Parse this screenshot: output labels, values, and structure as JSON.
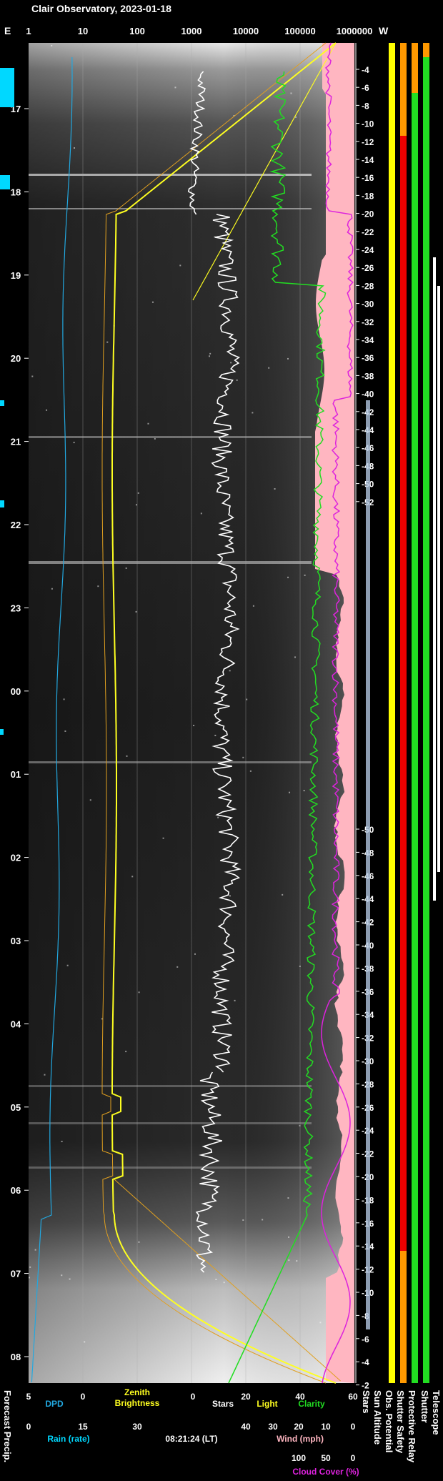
{
  "title": "Clair Observatory, 2023-01-18",
  "corner_label": "E",
  "right_header": "W",
  "colors": {
    "dpd": "#22a8e0",
    "brightness": "#ffff20",
    "brightness_alt": "#e0a020",
    "stars": "#ffffff",
    "clarity": "#22dd22",
    "cloud": "#dd22dd",
    "wind": "#ffb6c1",
    "rain": "#00d8ff",
    "sun": "#ffff00",
    "red": "#ee0000",
    "green": "#22dd22",
    "orange": "#ff9900"
  },
  "chart_data": {
    "type": "line",
    "time_labels": [
      "17",
      "18",
      "19",
      "20",
      "21",
      "22",
      "23",
      "00",
      "01",
      "02",
      "03",
      "04",
      "05",
      "06",
      "07",
      "08"
    ],
    "top_axis": {
      "labels": [
        "1",
        "10",
        "100",
        "1000",
        "10000",
        "100000",
        "1000000"
      ],
      "scale": "log"
    },
    "sun_altitude_labels_top": [
      "-4",
      "-6",
      "-8",
      "-10",
      "-12",
      "-14",
      "-16",
      "-18",
      "-20",
      "-22",
      "-24",
      "-26",
      "-28",
      "-30",
      "-32",
      "-34",
      "-36",
      "-38",
      "-40",
      "-42",
      "-44",
      "-46",
      "-48",
      "-50",
      "-52"
    ],
    "sun_altitude_labels_bottom": [
      "-50",
      "-48",
      "-46",
      "-44",
      "-42",
      "-40",
      "-38",
      "-36",
      "-34",
      "-32",
      "-30",
      "-28",
      "-26",
      "-24",
      "-22",
      "-20",
      "-18",
      "-16",
      "-14",
      "-12",
      "-10",
      "-8",
      "-6",
      "-4",
      "-2"
    ],
    "bottom_axes": {
      "dpd": {
        "ticks": [
          "5",
          "0"
        ],
        "label": "DPD"
      },
      "brightness": {
        "ticks": [
          "20"
        ],
        "label1": "Zenith",
        "label2": "Brightness"
      },
      "stars": {
        "ticks": [
          "0"
        ],
        "label": "Stars"
      },
      "light": {
        "ticks": [
          "20"
        ],
        "label": "Light"
      },
      "clarity": {
        "ticks": [
          "40"
        ],
        "label": "Clarity"
      },
      "clarity_end": {
        "ticks": [
          "60"
        ]
      },
      "rain": {
        "ticks": [
          "0",
          "15",
          "30"
        ],
        "label": "Rain (rate)"
      },
      "wind": {
        "ticks": [
          "40",
          "30",
          "20",
          "10",
          "0"
        ],
        "label": "Wind (mph)"
      },
      "cloud": {
        "ticks": [
          "100",
          "50",
          "0"
        ],
        "label": "Cloud Cover (%)"
      }
    },
    "timestamp": "08:21:24 (LT)",
    "vertical_labels": {
      "forecast": "Forecast Precip.",
      "stars": "Stars",
      "sun": "Sun Altitude",
      "obs": "Obs. Potential",
      "shutter_safety": "Shutter Safety",
      "relay": "Protective Relay",
      "shutter": "Shutter",
      "telescope": "Telescope"
    }
  }
}
